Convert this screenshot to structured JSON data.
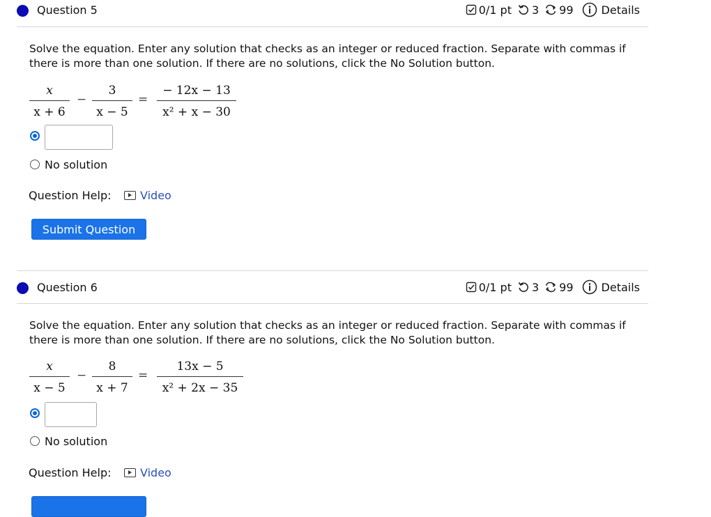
{
  "questions": [
    {
      "title": "Question 5",
      "meta": {
        "score": "0/1 pt",
        "retries": "3",
        "attempts": "99",
        "details": "Details"
      },
      "prompt": "Solve the equation. Enter any solution that checks as an integer or reduced fraction. Separate with commas if there is more than one solution. If there are no solutions, click the No Solution button.",
      "equation": {
        "f1_num": "x",
        "f1_den": "x + 6",
        "minus": "−",
        "f2_num": "3",
        "f2_den": "x − 5",
        "equals": "=",
        "f3_num": "− 12x − 13",
        "f3_den": "x² + x − 30"
      },
      "answer_value": "",
      "no_solution_label": "No solution",
      "help_label": "Question Help:",
      "video_label": "Video",
      "submit_label": "Submit Question"
    },
    {
      "title": "Question 6",
      "meta": {
        "score": "0/1 pt",
        "retries": "3",
        "attempts": "99",
        "details": "Details"
      },
      "prompt": "Solve the equation. Enter any solution that checks as an integer or reduced fraction. Separate with commas if there is more than one solution. If there are no solutions, click the No Solution button.",
      "equation": {
        "f1_num": "x",
        "f1_den": "x − 5",
        "minus": "−",
        "f2_num": "8",
        "f2_den": "x + 7",
        "equals": "=",
        "f3_num": "13x − 5",
        "f3_den": "x² + 2x − 35"
      },
      "answer_value": "",
      "no_solution_label": "No solution",
      "help_label": "Question Help:",
      "video_label": "Video"
    }
  ],
  "colors": {
    "bullet": "#0b0bb3",
    "accent": "#1a73e8",
    "link": "#2a4fb8"
  },
  "icons": {
    "score": "checkbox-icon",
    "retries": "retry-icon",
    "attempts": "attempts-icon",
    "details": "info-icon",
    "video": "play-icon"
  }
}
